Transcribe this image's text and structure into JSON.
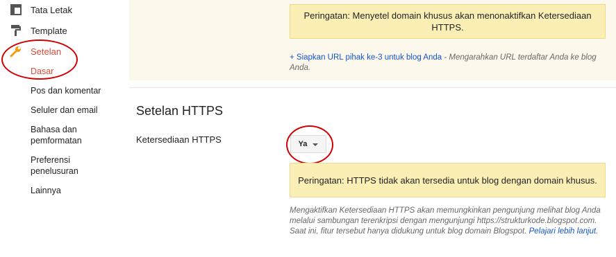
{
  "sidebar": {
    "items": [
      {
        "label": "Tata Letak",
        "icon": "layout-icon"
      },
      {
        "label": "Template",
        "icon": "paint-roller-icon"
      },
      {
        "label": "Setelan",
        "icon": "wrench-icon"
      }
    ],
    "sub_items": [
      "Dasar",
      "Pos dan komentar",
      "Seluler dan email",
      "Bahasa dan pemformatan",
      "Preferensi penelusuran",
      "Lainnya"
    ]
  },
  "top": {
    "warning": "Peringatan: Menyetel domain khusus akan menonaktifkan Ketersediaan HTTPS.",
    "link": "+ Siapkan URL pihak ke-3 untuk blog Anda",
    "link_desc": " - Mengarahkan URL terdaftar Anda ke blog Anda."
  },
  "https": {
    "title": "Setelan HTTPS",
    "label": "Ketersediaan HTTPS",
    "value": "Ya",
    "warning": "Peringatan: HTTPS tidak akan tersedia untuk blog dengan domain khusus.",
    "desc": "Mengaktifkan Ketersediaan HTTPS akan memungkinkan pengunjung melihat blog Anda melalui sambungan terenkripsi dengan mengunjungi https://strukturkode.blogspot.com. Saat ini, fitur tersebut hanya didukung untuk blog domain Blogspot. ",
    "learn_more": "Pelajari lebih lanjut",
    "learn_more_suffix": "."
  },
  "colors": {
    "accent": "#dd4b39",
    "link": "#1155cc",
    "warning_bg": "#fcefb6",
    "annotation": "#d00000"
  }
}
